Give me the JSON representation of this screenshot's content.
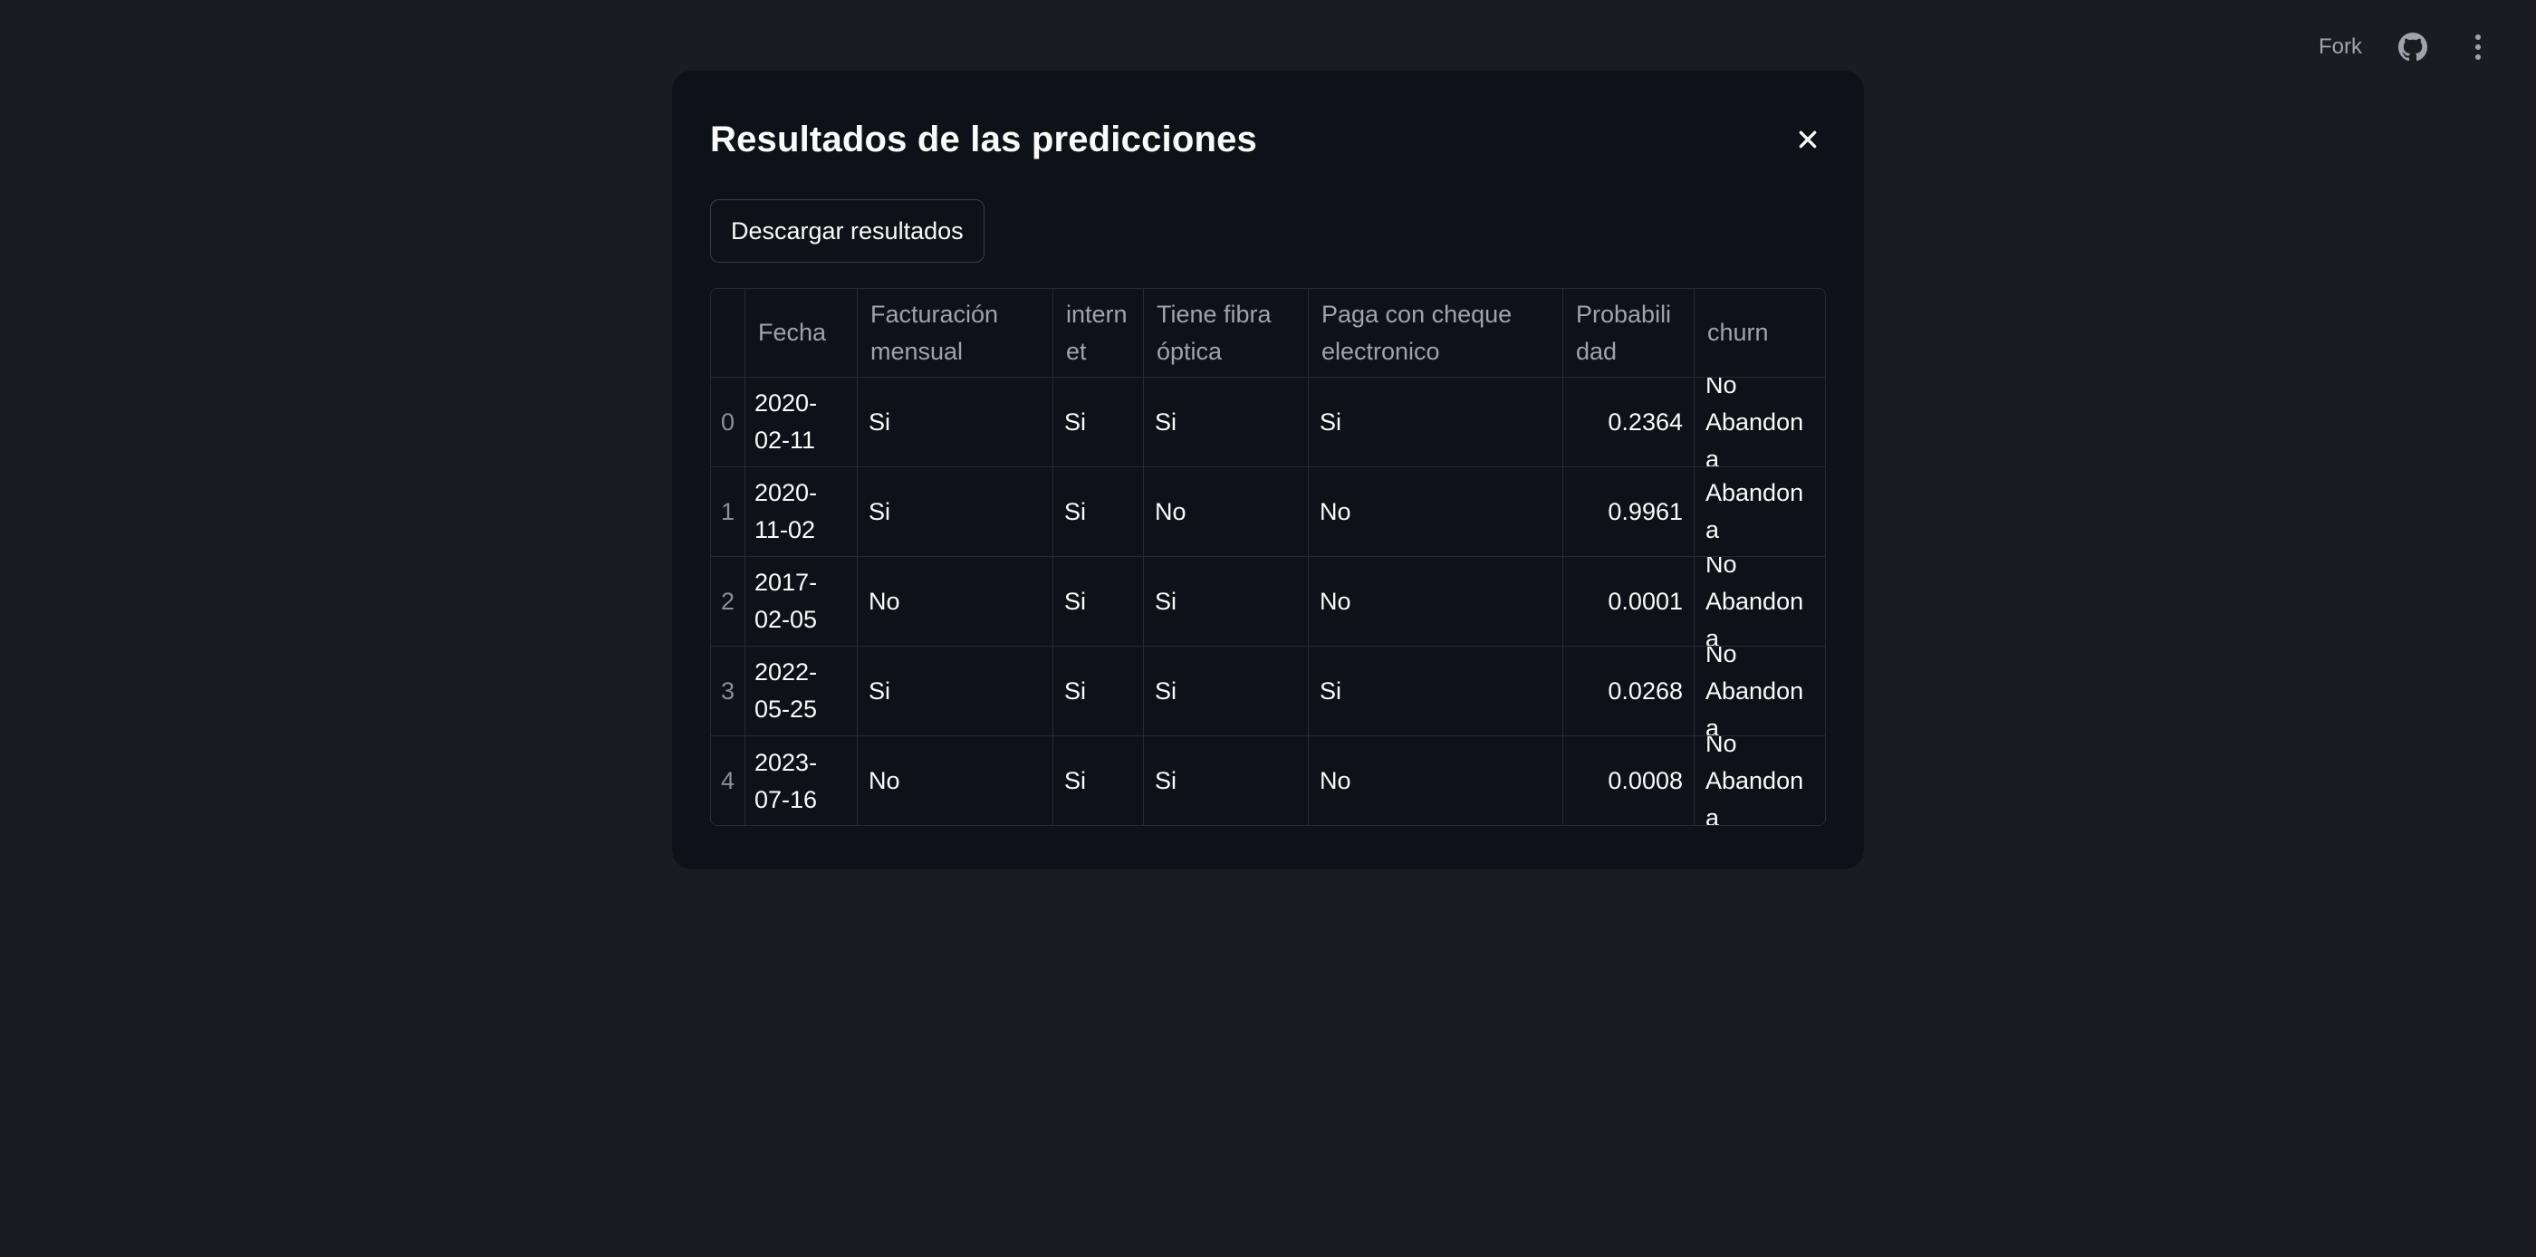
{
  "toolbar": {
    "fork_label": "Fork",
    "github_icon": "github-icon",
    "menu_icon": "kebab-menu-icon"
  },
  "modal": {
    "title": "Resultados de las predicciones",
    "close_icon": "close-icon",
    "download_label": "Descargar resultados"
  },
  "table": {
    "columns": [
      "",
      "Fecha",
      "Facturación mensual",
      "intern et",
      "Tiene fibra óptica",
      "Paga con cheque electronico",
      "Probabili dad",
      "churn"
    ],
    "rows": [
      {
        "index": "0",
        "fecha": "2020-02-11",
        "facturacion": "Si",
        "internet": "Si",
        "fibra": "Si",
        "cheque": "Si",
        "probabilidad": "0.2364",
        "churn": "No Abandona"
      },
      {
        "index": "1",
        "fecha": "2020-11-02",
        "facturacion": "Si",
        "internet": "Si",
        "fibra": "No",
        "cheque": "No",
        "probabilidad": "0.9961",
        "churn": "Abandona"
      },
      {
        "index": "2",
        "fecha": "2017-02-05",
        "facturacion": "No",
        "internet": "Si",
        "fibra": "Si",
        "cheque": "No",
        "probabilidad": "0.0001",
        "churn": "No Abandona"
      },
      {
        "index": "3",
        "fecha": "2022-05-25",
        "facturacion": "Si",
        "internet": "Si",
        "fibra": "Si",
        "cheque": "Si",
        "probabilidad": "0.0268",
        "churn": "No Abandona"
      },
      {
        "index": "4",
        "fecha": "2023-07-16",
        "facturacion": "No",
        "internet": "Si",
        "fibra": "Si",
        "cheque": "No",
        "probabilidad": "0.0008",
        "churn": "No Abandona"
      }
    ]
  },
  "colors": {
    "page_background": "#1b1c21",
    "modal_background": "#0e1117",
    "text": "#fafafa",
    "muted_text": "#9ea3ad",
    "border": "#262a33"
  }
}
